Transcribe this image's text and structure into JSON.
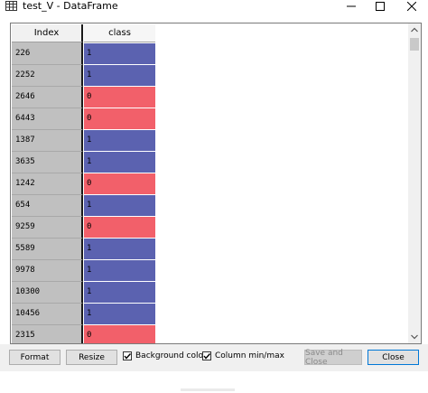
{
  "window": {
    "title": "test_V - DataFrame",
    "icons": {
      "app": "table-grid-icon",
      "minimize": "minimize-icon",
      "maximize": "maximize-icon",
      "close": "close-icon"
    }
  },
  "table": {
    "headers": {
      "index": "Index",
      "column": "class"
    },
    "rows": [
      {
        "index": "226",
        "value": "1"
      },
      {
        "index": "2252",
        "value": "1"
      },
      {
        "index": "2646",
        "value": "0"
      },
      {
        "index": "6443",
        "value": "0"
      },
      {
        "index": "1387",
        "value": "1"
      },
      {
        "index": "3635",
        "value": "1"
      },
      {
        "index": "1242",
        "value": "0"
      },
      {
        "index": "654",
        "value": "1"
      },
      {
        "index": "9259",
        "value": "0"
      },
      {
        "index": "5589",
        "value": "1"
      },
      {
        "index": "9978",
        "value": "1"
      },
      {
        "index": "10300",
        "value": "1"
      },
      {
        "index": "10456",
        "value": "1"
      },
      {
        "index": "2315",
        "value": "0"
      }
    ],
    "colors": {
      "value_1": "#5b62b0",
      "value_0": "#f2606a",
      "index_bg": "#c0c0c0"
    }
  },
  "toolbar": {
    "format_label": "Format",
    "resize_label": "Resize",
    "background_color_label": "Background color",
    "background_color_checked": true,
    "column_minmax_label": "Column min/max",
    "column_minmax_checked": true,
    "save_close_label": "Save and Close",
    "save_close_enabled": false,
    "close_label": "Close"
  }
}
